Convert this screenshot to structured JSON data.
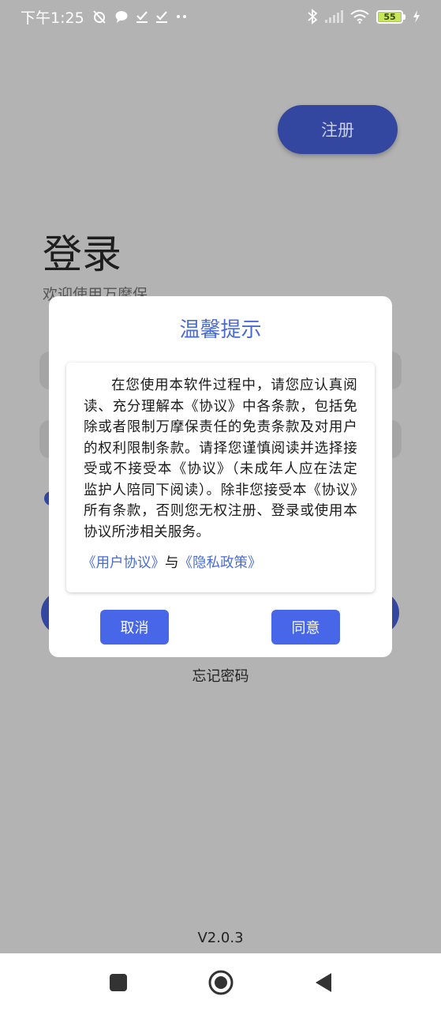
{
  "status_bar": {
    "time": "下午1:25",
    "battery_level": "55",
    "icons": [
      "alarm-muted-icon",
      "chat-bubble-icon",
      "check-download-icon",
      "check-download-icon",
      "more-dots-icon",
      "bluetooth-icon",
      "signal-icon",
      "wifi-icon",
      "battery-icon",
      "charging-icon"
    ]
  },
  "page": {
    "register_label": "注册",
    "login_title": "登录",
    "welcome_text": "欢迎使用万摩保",
    "forgot_password": "忘记密码",
    "version": "V2.0.3"
  },
  "dialog": {
    "title": "温馨提示",
    "body": "在您使用本软件过程中，请您应认真阅读、充分理解本《协议》中各条款，包括免除或者限制万摩保责任的免责条款及对用户的权利限制条款。请择您谨慎阅读并选择接受或不接受本《协议》（未成年人应在法定监护人陪同下阅读）。除非您接受本《协议》所有条款，否则您无权注册、登录或使用本协议所涉相关服务。",
    "user_agreement_link": "《用户协议》",
    "and_text": "与",
    "privacy_policy_link": "《隐私政策》",
    "cancel_label": "取消",
    "agree_label": "同意"
  },
  "colors": {
    "accent": "#4766e8",
    "title_blue": "#4a6cd0",
    "overlay_background": "#b3b3b3",
    "register_button": "#3347a0"
  },
  "nav_bar": {
    "icons": [
      "recents-square-icon",
      "home-circle-icon",
      "back-triangle-icon"
    ]
  }
}
